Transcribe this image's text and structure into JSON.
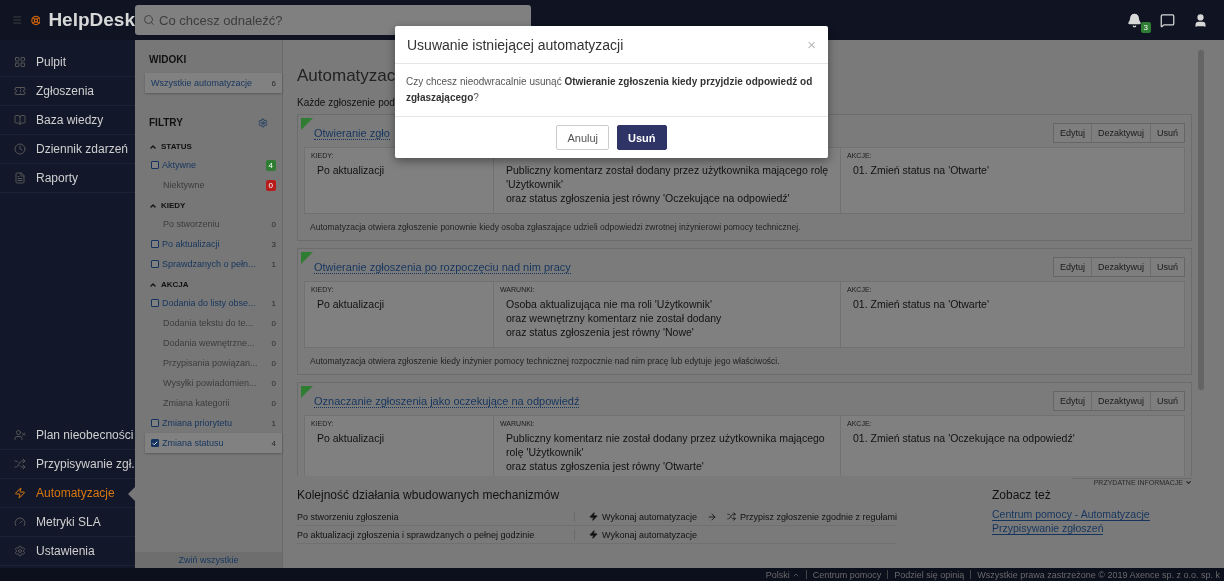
{
  "topbar": {
    "logo": "HelpDesk",
    "search": {
      "placeholder": "Co chcesz odnaleźć?"
    },
    "notifications": "3"
  },
  "sidebar": {
    "items": [
      {
        "label": "Pulpit",
        "selected": false
      },
      {
        "label": "Zgłoszenia",
        "selected": false
      },
      {
        "label": "Baza wiedzy",
        "selected": false
      },
      {
        "label": "Dziennik zdarzeń",
        "selected": false
      },
      {
        "label": "Raporty",
        "selected": false
      }
    ],
    "bottom_items": [
      {
        "label": "Plan nieobecności",
        "selected": false
      },
      {
        "label": "Przypisywanie zgł.",
        "selected": false
      },
      {
        "label": "Automatyzacje",
        "selected": true
      },
      {
        "label": "Metryki SLA",
        "selected": false
      },
      {
        "label": "Ustawienia",
        "selected": false
      }
    ]
  },
  "views": {
    "title": "WIDOKI",
    "items": [
      {
        "label": "Wszystkie automatyzacje",
        "count": "6",
        "selected": true
      }
    ]
  },
  "filters": {
    "title": "FILTRY",
    "sections": [
      {
        "title": "STATUS",
        "expanded": true,
        "items": [
          {
            "label": "Aktywne",
            "count": "4",
            "color": "#2e7d32",
            "disabled": false,
            "checked": false
          },
          {
            "label": "Niektywne",
            "count": "0",
            "color": "#b71c1c",
            "disabled": true,
            "checked": false
          }
        ]
      },
      {
        "title": "KIEDY",
        "expanded": true,
        "items": [
          {
            "label": "Po stworzeniu",
            "count": "0",
            "disabled": true,
            "checked": false
          },
          {
            "label": "Po aktualizacji",
            "count": "3",
            "disabled": false,
            "checked": false
          },
          {
            "label": "Sprawdzanych o pełn...",
            "count": "1",
            "disabled": false,
            "checked": false
          }
        ]
      },
      {
        "title": "AKCJA",
        "expanded": true,
        "items": [
          {
            "label": "Dodania do listy obse...",
            "count": "1",
            "disabled": false,
            "checked": false
          },
          {
            "label": "Dodania tekstu do te...",
            "count": "0",
            "disabled": true,
            "checked": false
          },
          {
            "label": "Dodania wewnętrzne...",
            "count": "0",
            "disabled": true,
            "checked": false
          },
          {
            "label": "Przypisania powiązan...",
            "count": "0",
            "disabled": true,
            "checked": false
          },
          {
            "label": "Wysyłki powiadomien...",
            "count": "0",
            "disabled": true,
            "checked": false
          },
          {
            "label": "Zmiana kategorii",
            "count": "0",
            "disabled": true,
            "checked": false
          },
          {
            "label": "Zmiana priorytetu",
            "count": "1",
            "disabled": false,
            "checked": false
          },
          {
            "label": "Zmiana statusu",
            "count": "4",
            "disabled": false,
            "checked": true
          }
        ]
      }
    ],
    "collapse_button": "Zwiń wszystkie"
  },
  "main": {
    "title": "Automatyzac",
    "subtitle": "Każde zgłoszenie pod",
    "cards": [
      {
        "title": "Otwieranie zgło",
        "active": true,
        "buttons": [
          "Edytuj",
          "Dezaktywuj",
          "Usuń"
        ],
        "when": {
          "label": "KIEDY:",
          "value": "Po aktualizacji"
        },
        "conditions": {
          "lines": [
            "Publiczny komentarz został dodany przez użytkownika mającego rolę 'Użytkownik'",
            "oraz status zgłoszenia jest równy 'Oczekujące na odpowiedź'"
          ]
        },
        "actions": {
          "label": "AKCJE:",
          "lines": [
            "01. Zmień status na 'Otwarte'"
          ]
        },
        "description": "Automatyzacja otwiera zgłoszenie ponownie kiedy osoba zgłaszające udzieli odpowiedzi zwrotnej inżynierowi pomocy technicznej."
      },
      {
        "title": "Otwieranie zgłoszenia po rozpoczęciu nad nim pracy",
        "active": true,
        "buttons": [
          "Edytuj",
          "Dezaktywuj",
          "Usuń"
        ],
        "when": {
          "label": "KIEDY:",
          "value": "Po aktualizacji"
        },
        "conditions": {
          "label": "WARUNKI:",
          "lines": [
            "Osoba aktualizująca nie ma roli 'Użytkownik'",
            "oraz wewnętrzny komentarz nie został dodany",
            "oraz status zgłoszenia jest równy 'Nowe'"
          ]
        },
        "actions": {
          "label": "AKCJE:",
          "lines": [
            "01. Zmień status na 'Otwarte'"
          ]
        },
        "description": "Automatyzacja otwiera zgłoszenie kiedy inżynier pomocy technicznej rozpocznie nad nim pracę lub edytuje jego właściwości."
      },
      {
        "title": "Oznaczanie zgłoszenia jako oczekujące na odpowiedź",
        "active": true,
        "buttons": [
          "Edytuj",
          "Dezaktywuj",
          "Usuń"
        ],
        "when": {
          "label": "KIEDY:",
          "value": "Po aktualizacji"
        },
        "conditions": {
          "label": "WARUNKI:",
          "lines": [
            "Publiczny komentarz nie został dodany przez użytkownika mającego rolę 'Użytkownik'",
            "oraz status zgłoszenia jest równy 'Otwarte'"
          ]
        },
        "actions": {
          "label": "AKCJE:",
          "lines": [
            "01. Zmień status na 'Oczekujące na odpowiedź'"
          ]
        }
      }
    ]
  },
  "info": {
    "toggle": "PRZYDATNE INFORMACJE",
    "order_title": "Kolejność działania wbudowanych mechanizmów",
    "rows": [
      {
        "label": "Po stworzeniu zgłoszenia",
        "steps": [
          {
            "kind": "automation",
            "text": "Wykonaj automatyzacje"
          },
          {
            "kind": "assign",
            "text": "Przypisz zgłoszenie zgodnie z regułami"
          }
        ]
      },
      {
        "label": "Po aktualizacji zgłoszenia i sprawdzanych o pełnej godzinie",
        "steps": [
          {
            "kind": "automation",
            "text": "Wykonaj automatyzacje"
          }
        ]
      }
    ],
    "see_also_title": "Zobacz też",
    "links": [
      "Centrum pomocy - Automatyzacje",
      "Przypisywanie zgłoszeń"
    ]
  },
  "footer": {
    "language": "Polski",
    "links": [
      "Centrum pomocy",
      "Podziel się opinią"
    ],
    "copyright": "Wszystkie prawa zastrzeżone © 2019 Axence sp. z o.o. sp. k"
  },
  "modal": {
    "title": "Usuwanie istniejącej automatyzacji",
    "close": "×",
    "message": "Czy chcesz nieodwracalnie usunąć **Otwieranie zgłoszenia kiedy przyjdzie odpowiedź od zgłaszającego**?",
    "buttons": [
      {
        "kind": "secondary",
        "label": "Anuluj"
      },
      {
        "kind": "primary",
        "label": "Usuń"
      }
    ]
  }
}
